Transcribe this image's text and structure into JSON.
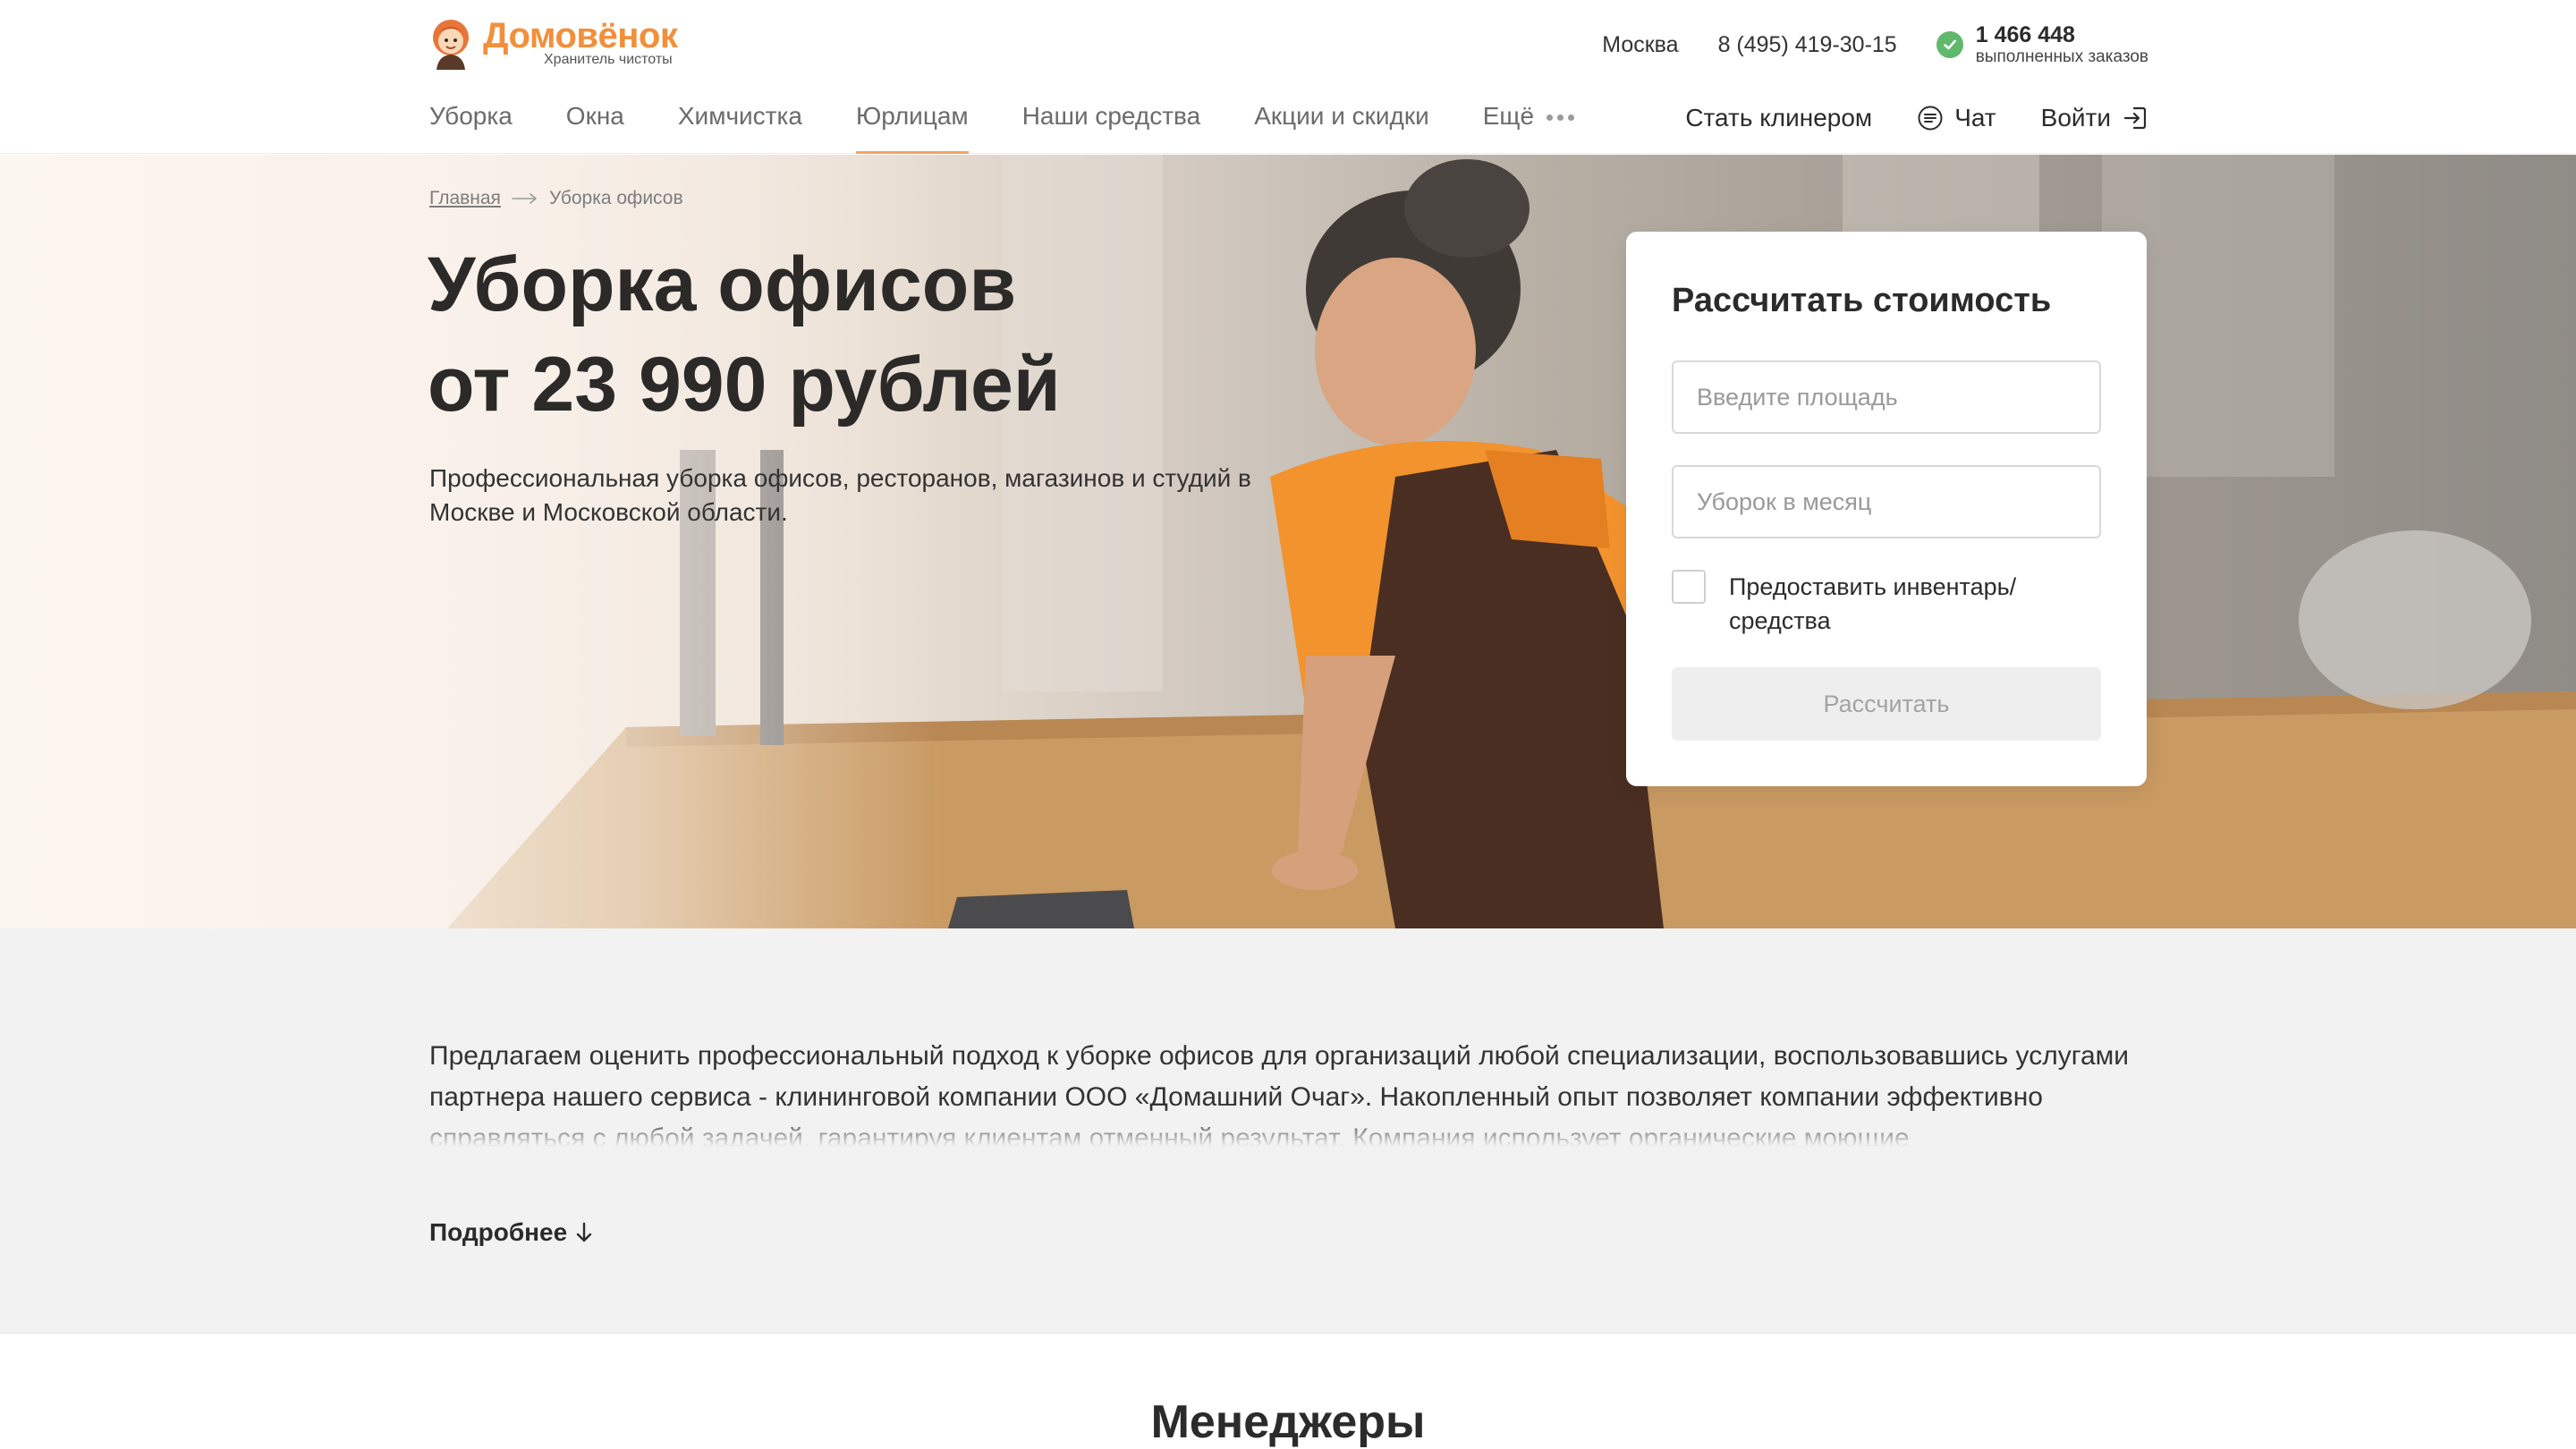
{
  "brand": {
    "name": "Домовёнок",
    "tagline": "Хранитель чистоты",
    "accent": "#f28f3b"
  },
  "header": {
    "city": "Москва",
    "phone": "8 (495) 419-30-15",
    "orders_count": "1 466 448",
    "orders_label": "выполненных заказов",
    "check_color": "#5fb86b"
  },
  "nav": {
    "items": [
      {
        "label": "Уборка"
      },
      {
        "label": "Окна"
      },
      {
        "label": "Химчистка"
      },
      {
        "label": "Юрлицам",
        "active": true
      },
      {
        "label": "Наши средства"
      },
      {
        "label": "Акции и скидки"
      },
      {
        "label": "Ещё"
      }
    ],
    "become_cleaner": "Стать клинером",
    "chat": "Чат",
    "login": "Войти"
  },
  "breadcrumb": {
    "home": "Главная",
    "current": "Уборка офисов"
  },
  "hero": {
    "title_line1": "Уборка офисов",
    "title_line2": "от 23 990 рублей",
    "subtitle": "Профессиональная уборка офисов, ресторанов, магазинов и студий в Москве и Московской области."
  },
  "calculator": {
    "title": "Рассчитать стоимость",
    "area_placeholder": "Введите площадь",
    "count_placeholder": "Уборок в месяц",
    "inventory_label": "Предоставить инвентарь/средства",
    "inventory_checked": false,
    "submit_label": "Рассчитать"
  },
  "about": {
    "text": "Предлагаем оценить профессиональный подход к уборке офисов для организаций любой специализации, воспользовавшись услугами партнера нашего сервиса - клининговой компании ООО «Домашний Очаг». Накопленный опыт позволяет компании эффективно справляться с любой задачей, гарантируя клиентам отменный результат. Компания использует органические моющие",
    "more_label": "Подробнее"
  },
  "managers": {
    "title": "Менеджеры"
  }
}
